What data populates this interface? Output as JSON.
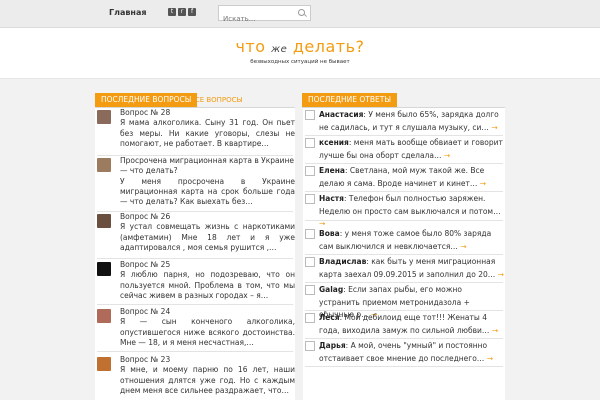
{
  "topbar": {
    "home_label": "Главная",
    "search_placeholder": "Искать..."
  },
  "header": {
    "logo_part1": "что",
    "logo_part2": "же",
    "logo_part3": "делать?",
    "tagline": "безвыходных ситуаций не бывает"
  },
  "questions": {
    "title": "ПОСЛЕДНИЕ ВОПРОСЫ",
    "all_link": "ВСЕ ВОПРОСЫ",
    "items": [
      {
        "title": "Вопрос № 28",
        "body": "Я мама алкоголика. Сыну 31 год. Он пьет без меры. Ни какие уговоры, слезы не помогают, не работает. В квартире…",
        "thumb_color": "#8a6a5a"
      },
      {
        "title": "Просрочена миграционная карта в Украине — что делать?",
        "body": "У меня просрочена в Украине миграционная карта на срок больше года — что делать? Как выехать без…",
        "thumb_color": "#9c7b5e"
      },
      {
        "title": "Вопрос № 26",
        "body": "Я устал совмещать жизнь с наркотиками (амфетамин) Мне 18 лет и я уже адаптировался , моя семья рушится ,…",
        "thumb_color": "#6b4f3f"
      },
      {
        "title": "Вопрос № 25",
        "body": "Я люблю парня, но подозреваю, что он пользуется мной. Проблема в том, что мы сейчас живем в разных городах – я…",
        "thumb_color": "#111111"
      },
      {
        "title": "Вопрос № 24",
        "body": "Я — сын конченого алкоголика, опустившегося ниже всякого достоинства. Мне — 18, и я меня несчастная,…",
        "thumb_color": "#b06a5a"
      },
      {
        "title": "Вопрос № 23",
        "body": "Я мне, и моему парню по 16 лет, наши отношения длятся уже год. Но с каждым днем меня все сильнее раздражает, что…",
        "thumb_color": "#c07030"
      }
    ]
  },
  "answers": {
    "title": "ПОСЛЕДНИЕ ОТВЕТЫ",
    "items": [
      {
        "name": "Анастасия",
        "text": ": У меня было 65%, зарядка долго не садилась, и тут я слушала музыку, си…"
      },
      {
        "name": "ксения",
        "text": ": меня мать вообще обвиает и говорит лучше бы она оборт сделала…"
      },
      {
        "name": "Елена",
        "text": ": Светлана, мой муж такой же. Все делаю я сама. Вроде начинет и кинет…"
      },
      {
        "name": "Настя",
        "text": ": Телефон был полностью заряжен. Неделю он просто сам выключался и потом…"
      },
      {
        "name": "Вова",
        "text": ": у меня тоже самое было 80% заряда сам выключился и невключается…"
      },
      {
        "name": "Владислав",
        "text": ": как быть у меня миграционная карта заехал 09.09.2015 и заполнил до 20…"
      },
      {
        "name": "Galag",
        "text": ": Если запах рыбы, его можно устранить приемом метронидазола + обычные р…"
      },
      {
        "name": "Леся",
        "text": ": Мой дебилоид еще тот!!! Женаты 4 года, виходила замуж по сильной любви…"
      },
      {
        "name": "Дарья",
        "text": ": А мой, очень \"умный\" и постоянно отстаивает свое мнение до последнего…"
      }
    ]
  },
  "colors": {
    "accent": "#f39c12"
  }
}
